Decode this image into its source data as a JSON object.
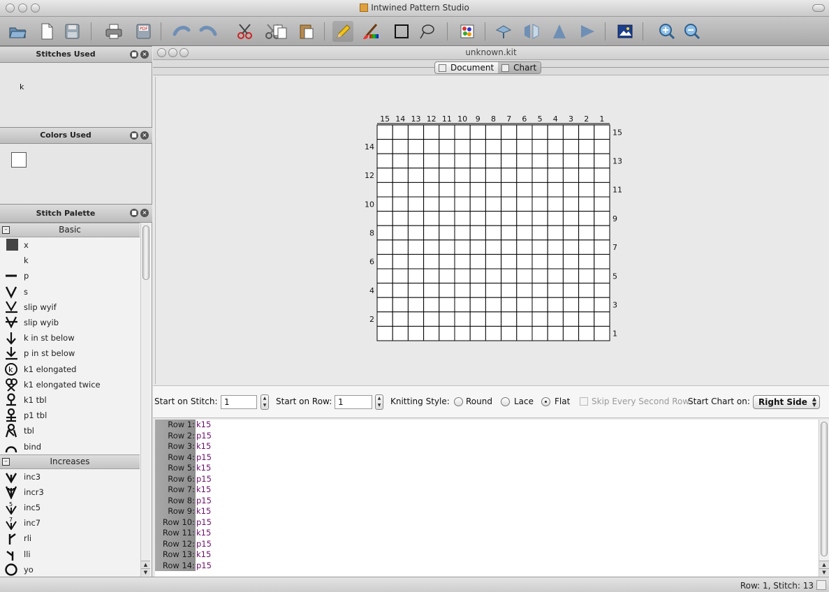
{
  "window": {
    "title": "Intwined Pattern Studio"
  },
  "document": {
    "title": "unknown.kit",
    "tabs": [
      {
        "label": "Document",
        "selected": false
      },
      {
        "label": "Chart",
        "selected": true
      }
    ]
  },
  "panels": {
    "stitches_used": {
      "title": "Stitches Used",
      "items": [
        "k"
      ]
    },
    "colors_used": {
      "title": "Colors Used",
      "swatch_color": "#ffffff"
    },
    "stitch_palette": {
      "title": "Stitch Palette",
      "groups": [
        {
          "name": "Basic",
          "items": [
            {
              "label": "x",
              "icon": "filled-square-icon"
            },
            {
              "label": "k",
              "icon": "blank-icon"
            },
            {
              "label": "p",
              "icon": "dash-icon"
            },
            {
              "label": "s",
              "icon": "v-icon"
            },
            {
              "label": "slip wyif",
              "icon": "slip-wyif-icon"
            },
            {
              "label": "slip wyib",
              "icon": "slip-wyib-icon"
            },
            {
              "label": "k in st below",
              "icon": "down-arrow-icon"
            },
            {
              "label": "p in st below",
              "icon": "down-arrow-bar-icon"
            },
            {
              "label": "k1 elongated",
              "icon": "circle-k-icon"
            },
            {
              "label": "k1 elongated twice",
              "icon": "double-loop-icon"
            },
            {
              "label": "k1 tbl",
              "icon": "twisted-loop-icon"
            },
            {
              "label": "p1 tbl",
              "icon": "twisted-loop-bar-icon"
            },
            {
              "label": "tbl",
              "icon": "crossed-loop-icon"
            },
            {
              "label": "bind",
              "icon": "arc-icon"
            }
          ]
        },
        {
          "name": "Increases",
          "items": [
            {
              "label": "inc3",
              "icon": "inc3-icon"
            },
            {
              "label": "incr3",
              "icon": "incr3-icon"
            },
            {
              "label": "inc5",
              "icon": "inc5-icon"
            },
            {
              "label": "inc7",
              "icon": "inc7-icon"
            },
            {
              "label": "rli",
              "icon": "rli-icon"
            },
            {
              "label": "lli",
              "icon": "lli-icon"
            },
            {
              "label": "yo",
              "icon": "circle-icon"
            }
          ]
        }
      ]
    }
  },
  "chart": {
    "columns": 15,
    "rows": 15,
    "top_labels": [
      "15",
      "14",
      "13",
      "12",
      "11",
      "10",
      "9",
      "8",
      "7",
      "6",
      "5",
      "4",
      "3",
      "2",
      "1"
    ],
    "right_labels": [
      "15",
      "13",
      "11",
      "9",
      "7",
      "5",
      "3",
      "1"
    ],
    "left_labels": [
      "14",
      "12",
      "10",
      "8",
      "6",
      "4",
      "2"
    ]
  },
  "options": {
    "start_on_stitch_label": "Start on Stitch:",
    "start_on_stitch_value": "1",
    "start_on_row_label": "Start on Row:",
    "start_on_row_value": "1",
    "knitting_style_label": "Knitting Style:",
    "style_round": "Round",
    "style_lace": "Lace",
    "style_flat": "Flat",
    "selected_style": "Flat",
    "skip_label": "Skip Every Second Row",
    "start_chart_label": "Start Chart on:",
    "start_chart_value": "Right Side"
  },
  "row_instructions": [
    {
      "label": "Row 1:",
      "text": "k15"
    },
    {
      "label": "Row 2:",
      "text": "p15"
    },
    {
      "label": "Row 3:",
      "text": "k15"
    },
    {
      "label": "Row 4:",
      "text": "p15"
    },
    {
      "label": "Row 5:",
      "text": "k15"
    },
    {
      "label": "Row 6:",
      "text": "p15"
    },
    {
      "label": "Row 7:",
      "text": "k15"
    },
    {
      "label": "Row 8:",
      "text": "p15"
    },
    {
      "label": "Row 9:",
      "text": "k15"
    },
    {
      "label": "Row 10:",
      "text": "p15"
    },
    {
      "label": "Row 11:",
      "text": "k15"
    },
    {
      "label": "Row 12:",
      "text": "p15"
    },
    {
      "label": "Row 13:",
      "text": "k15"
    },
    {
      "label": "Row 14:",
      "text": "p15"
    }
  ],
  "status": {
    "text": "Row: 1, Stitch: 13"
  }
}
